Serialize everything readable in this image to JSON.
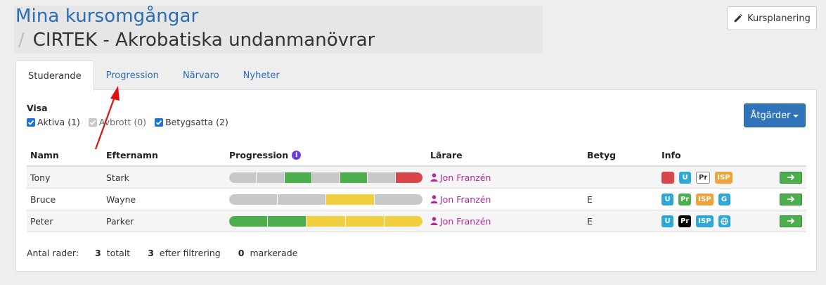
{
  "header": {
    "title": "Mina kursomgångar",
    "separator": "/",
    "course": "CIRTEK - Akrobatiska undanmanövrar",
    "plan_button": "Kursplanering"
  },
  "tabs": [
    {
      "label": "Studerande",
      "active": true
    },
    {
      "label": "Progression",
      "active": false
    },
    {
      "label": "Närvaro",
      "active": false
    },
    {
      "label": "Nyheter",
      "active": false
    }
  ],
  "filters": {
    "title": "Visa",
    "items": [
      {
        "label": "Aktiva (1)",
        "checked": true,
        "disabled": false
      },
      {
        "label": "Avbrott (0)",
        "checked": true,
        "disabled": true
      },
      {
        "label": "Betygsatta (2)",
        "checked": true,
        "disabled": false
      }
    ]
  },
  "actions_button": "Åtgärder",
  "table": {
    "columns": [
      "Namn",
      "Efternamn",
      "Progression",
      "Lärare",
      "Betyg",
      "Info"
    ],
    "rows": [
      {
        "first": "Tony",
        "last": "Stark",
        "teacher": "Jon Franzén",
        "grade": "",
        "progress": [
          "gray",
          "gray",
          "green",
          "gray",
          "green",
          "gray",
          "red"
        ],
        "badges": [
          {
            "text": "",
            "style": "red",
            "icon": "red-square"
          },
          {
            "text": "U",
            "style": "blue"
          },
          {
            "text": "Pr",
            "style": "outline"
          },
          {
            "text": "ISP",
            "style": "orange"
          }
        ]
      },
      {
        "first": "Bruce",
        "last": "Wayne",
        "teacher": "Jon Franzén",
        "grade": "E",
        "progress": [
          "gray",
          "gray",
          "yellow",
          "gray"
        ],
        "badges": [
          {
            "text": "U",
            "style": "blue"
          },
          {
            "text": "Pr",
            "style": "green"
          },
          {
            "text": "ISP",
            "style": "orange"
          },
          {
            "text": "G",
            "style": "blue"
          }
        ]
      },
      {
        "first": "Peter",
        "last": "Parker",
        "teacher": "Jon Franzén",
        "grade": "E",
        "progress": [
          "green",
          "green",
          "yellow",
          "yellow",
          "yellow"
        ],
        "badges": [
          {
            "text": "U",
            "style": "blue"
          },
          {
            "text": "Pr",
            "style": "black"
          },
          {
            "text": "ISP",
            "style": "blue"
          },
          {
            "text": "",
            "style": "globe",
            "icon": "globe"
          }
        ]
      }
    ]
  },
  "footer": {
    "label": "Antal rader:",
    "total_count": "3",
    "total_label": "totalt",
    "filtered_count": "3",
    "filtered_label": "efter filtrering",
    "marked_count": "0",
    "marked_label": "markerade"
  }
}
